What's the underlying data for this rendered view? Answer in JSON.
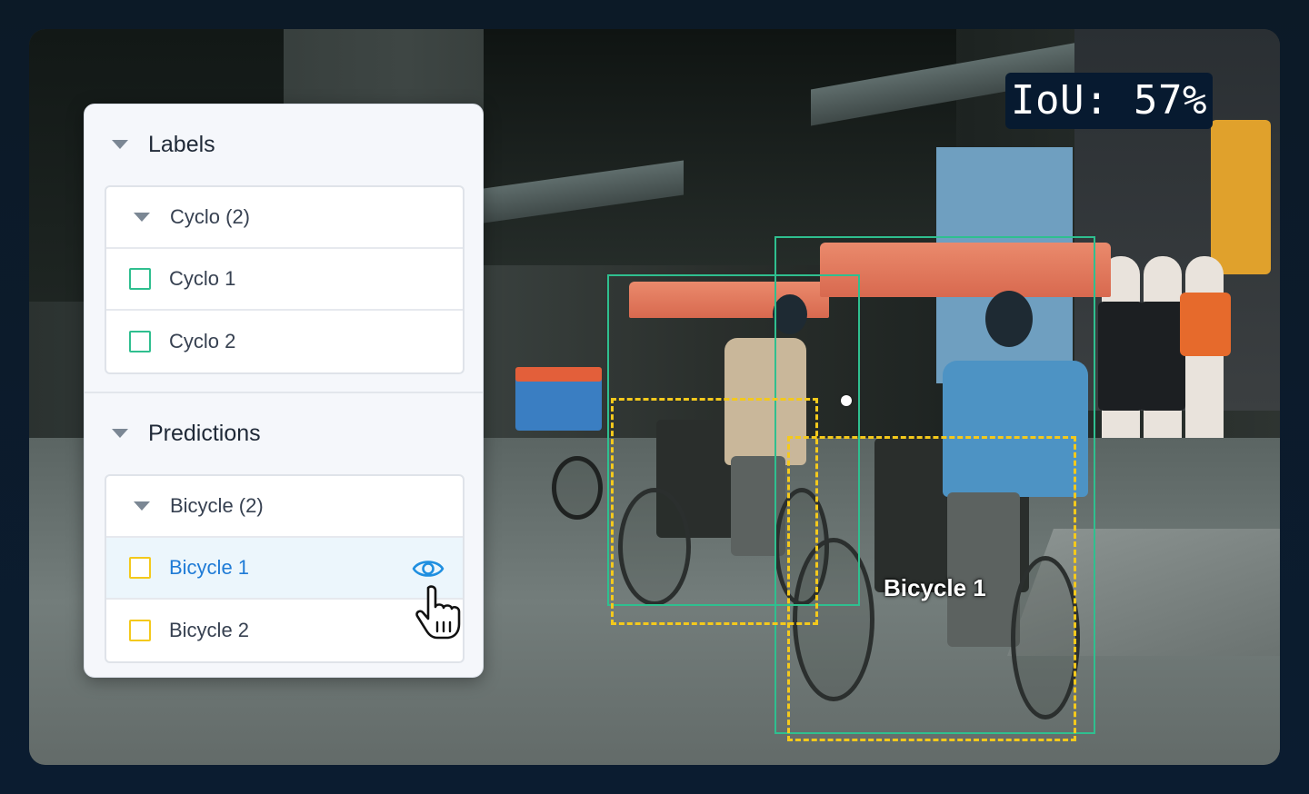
{
  "iou_badge": "IoU: 57%",
  "panel": {
    "labels_section": {
      "title": "Labels",
      "group": "Cyclo (2)",
      "items": [
        "Cyclo 1",
        "Cyclo 2"
      ]
    },
    "predictions_section": {
      "title": "Predictions",
      "group": "Bicycle (2)",
      "items": [
        "Bicycle 1",
        "Bicycle 2"
      ],
      "selected_item": "Bicycle 1"
    }
  },
  "overlay": {
    "selected_caption": "Bicycle 1"
  },
  "colors": {
    "label_box": "#2fbf8f",
    "prediction_box": "#f4c91c",
    "selected_text": "#1f7bd6",
    "badge_bg": "#071a30"
  },
  "icons": {
    "group_toggle": "caret-down-icon",
    "visibility": "eye-icon",
    "pointer": "hand-cursor-icon"
  }
}
